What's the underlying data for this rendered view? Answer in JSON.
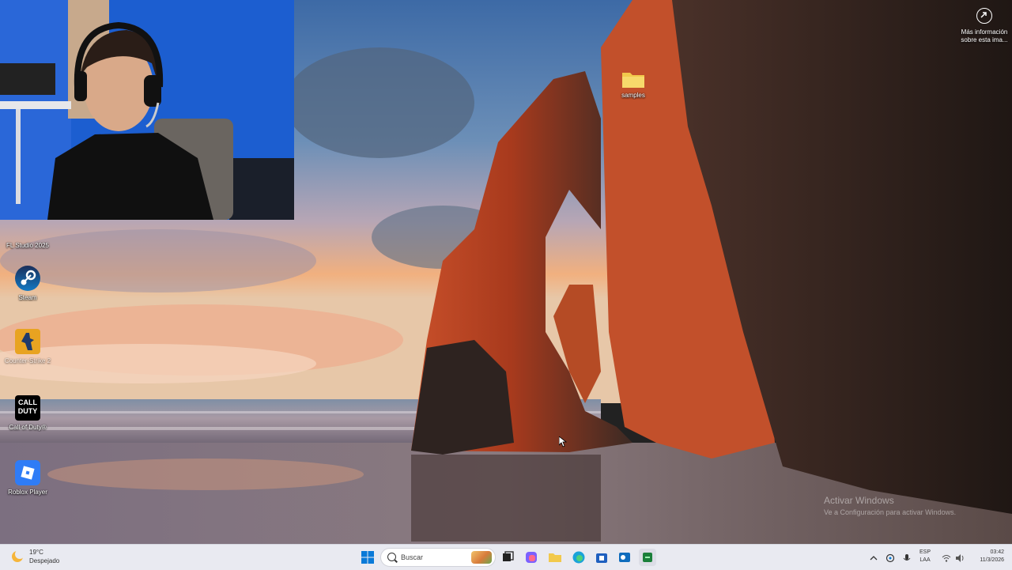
{
  "desktop": {
    "icons": [
      {
        "name": "FL Studio 2025",
        "kind": "fl-studio-icon"
      },
      {
        "name": "Steam",
        "kind": "steam-icon"
      },
      {
        "name": "Counter-Strike 2",
        "kind": "counter-strike-icon"
      },
      {
        "name": "Call of Duty®",
        "kind": "call-of-duty-icon"
      },
      {
        "name": "Roblox Player",
        "kind": "roblox-icon"
      },
      {
        "name": "samples",
        "kind": "folder-icon"
      }
    ],
    "cod_logo_line1": "CALL",
    "cod_logo_line2": "DUTY",
    "info": {
      "line1": "Más información",
      "line2": "sobre esta ima..."
    },
    "watermark": {
      "title": "Activar Windows",
      "subtitle": "Ve a Configuración para activar Windows."
    }
  },
  "taskbar": {
    "weather": {
      "temp": "19°C",
      "condition": "Despejado"
    },
    "search_placeholder": "Buscar",
    "language": {
      "line1": "ESP",
      "line2": "LAA"
    },
    "clock": {
      "time": "03:42",
      "date": "11/3/2026"
    },
    "pinned": [
      "windows-start",
      "task-view",
      "copilot",
      "file-explorer",
      "edge",
      "microsoft-store",
      "outlook",
      "terminal"
    ],
    "colors": {
      "bar": "#e9eaf1",
      "accent": "#0078d4"
    }
  }
}
